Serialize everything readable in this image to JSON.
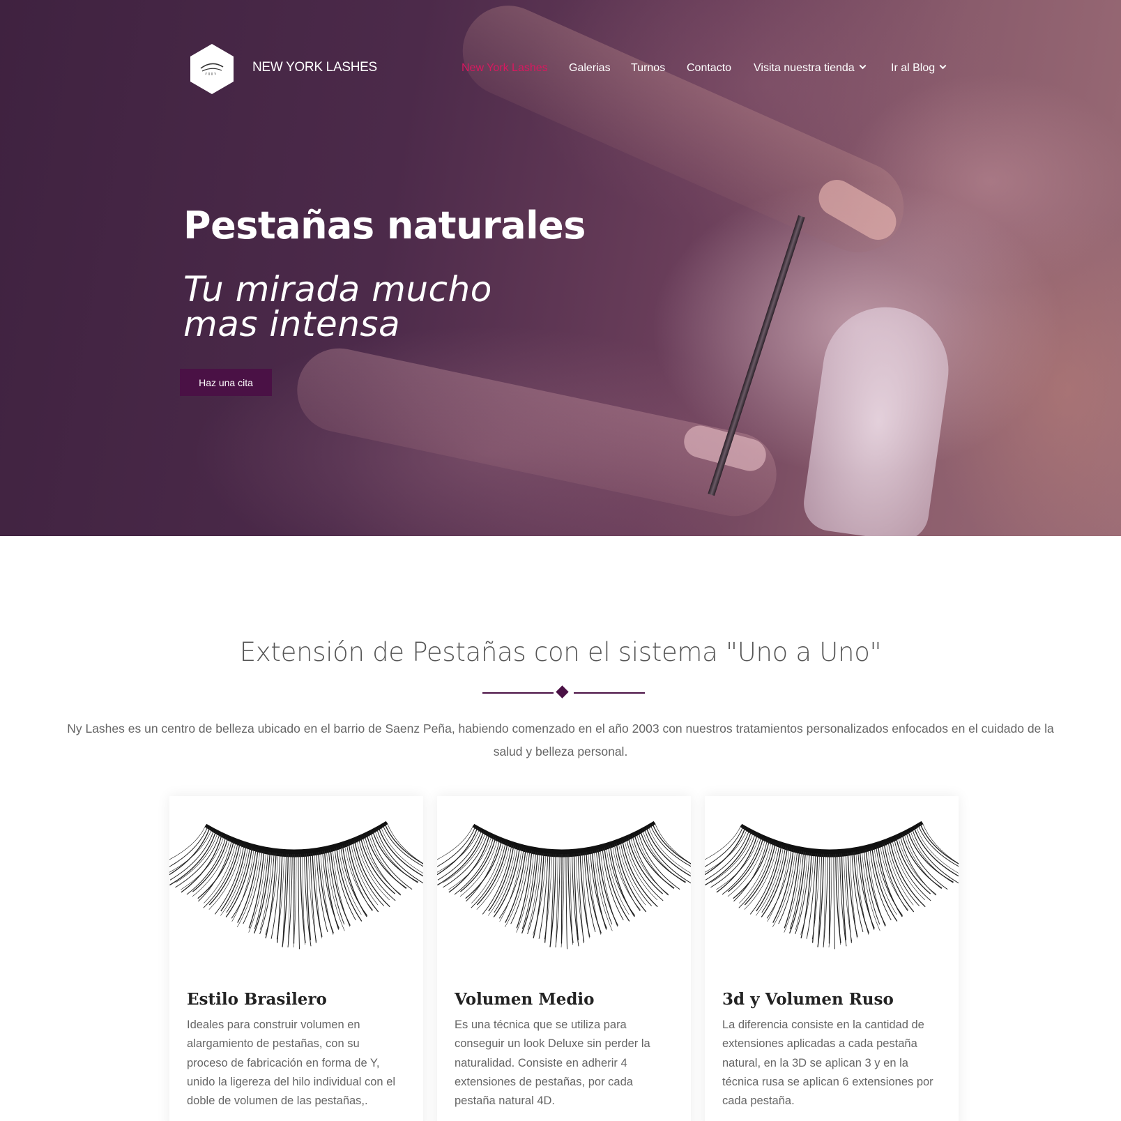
{
  "header": {
    "brand": "NEW YORK LASHES",
    "nav": [
      {
        "label": "New York Lashes",
        "active": true,
        "dropdown": false
      },
      {
        "label": "Galerias",
        "active": false,
        "dropdown": false
      },
      {
        "label": "Turnos",
        "active": false,
        "dropdown": false
      },
      {
        "label": "Contacto",
        "active": false,
        "dropdown": false
      },
      {
        "label": "Visita nuestra tienda",
        "active": false,
        "dropdown": true
      },
      {
        "label": "Ir al Blog",
        "active": false,
        "dropdown": true
      }
    ]
  },
  "hero": {
    "title": "Pestañas naturales",
    "subtitle": "Tu mirada mucho mas intensa",
    "cta": "Haz una cita"
  },
  "section": {
    "title": "Extensión de Pestañas con el sistema \"Uno a Uno\"",
    "intro": "Ny Lashes es un centro de belleza ubicado en el barrio de Saenz Peña, habiendo comenzado en el año 2003 con nuestros tratamientos personalizados enfocados en el cuidado de la salud y belleza personal."
  },
  "cards": [
    {
      "title": "Estilo Brasilero",
      "text": "Ideales para construir volumen en alargamiento de pestañas, con su proceso de fabricación en forma de Y, unido la ligereza del hilo individual con el doble de volumen de las pestañas,."
    },
    {
      "title": "Volumen Medio",
      "text": "Es una técnica que se utiliza para conseguir un look Deluxe sin perder la naturalidad. Consiste en adherir 4 extensiones de pestañas, por cada pestaña natural 4D."
    },
    {
      "title": "3d y Volumen Ruso",
      "text": "La diferencia consiste en la cantidad de extensiones aplicadas a cada pestaña natural, en la 3D se aplican 3 y en la técnica rusa se aplican 6 extensiones por cada pestaña."
    }
  ],
  "colors": {
    "accent": "#4a1145",
    "nav_active": "#d8185f"
  }
}
